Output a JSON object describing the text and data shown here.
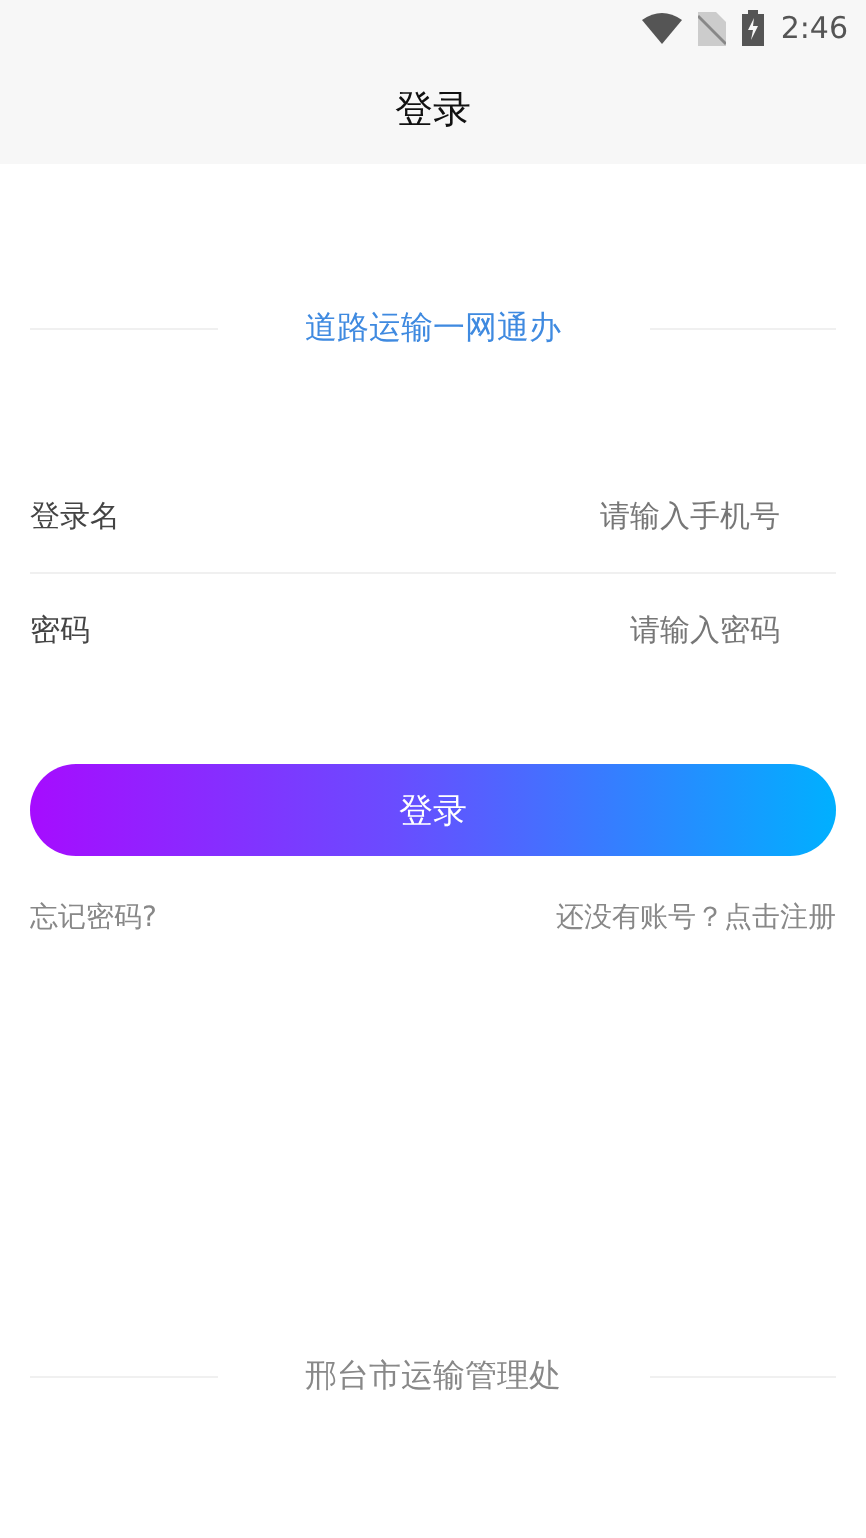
{
  "status_bar": {
    "time": "2:46"
  },
  "header": {
    "title": "登录"
  },
  "subtitle": "道路运输一网通办",
  "fields": [
    {
      "label": "登录名",
      "placeholder": "请输入手机号"
    },
    {
      "label": "密码",
      "placeholder": "请输入密码"
    }
  ],
  "login_button": "登录",
  "links": {
    "forgot": "忘记密码?",
    "register": "还没有账号？点击注册"
  },
  "footer": "邢台市运输管理处"
}
